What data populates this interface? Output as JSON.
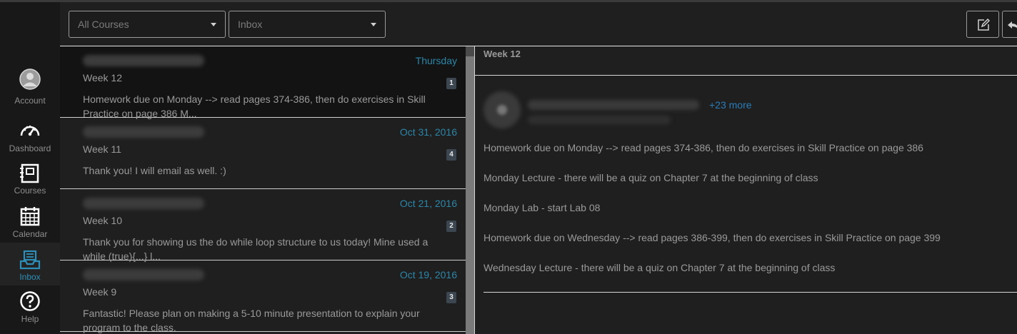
{
  "global_nav": {
    "account": "Account",
    "dashboard": "Dashboard",
    "courses": "Courses",
    "calendar": "Calendar",
    "inbox": "Inbox",
    "help": "Help"
  },
  "toolbar": {
    "course_filter": "All Courses",
    "mailbox_filter": "Inbox",
    "compose_icon": "compose-icon",
    "reply_icon": "reply-icon"
  },
  "messages": [
    {
      "date": "Thursday",
      "subject": "Week 12",
      "count": "1",
      "preview": "Homework due on Monday --> read pages 374-386, then do exercises in Skill Practice on page 386 M..."
    },
    {
      "date": "Oct 31, 2016",
      "subject": "Week 11",
      "count": "4",
      "preview": "Thank you! I will email as well. :)"
    },
    {
      "date": "Oct 21, 2016",
      "subject": "Week 10",
      "count": "2",
      "preview": "Thank you for showing us the do while loop structure to us today! Mine used a while (true){...} l..."
    },
    {
      "date": "Oct 19, 2016",
      "subject": "Week 9",
      "count": "3",
      "preview": "Fantastic! Please plan on making a 5-10 minute presentation to explain your program to the class."
    }
  ],
  "detail": {
    "subject": "Week 12",
    "more_recipients": "+23 more",
    "lines": [
      "Homework due on Monday --> read pages 374-386, then do exercises in Skill Practice on page 386",
      "Monday Lecture - there will be a quiz on Chapter 7 at the beginning of class",
      "Monday Lab - start Lab 08",
      "Homework due on Wednesday --> read pages 386-399, then do exercises in Skill Practice on page 399",
      "Wednesday Lecture - there will be a quiz on Chapter 7 at the beginning of class"
    ]
  },
  "colors": {
    "accent": "#2b86a8",
    "link": "#2a7db8",
    "background": "#1f1f1f"
  }
}
